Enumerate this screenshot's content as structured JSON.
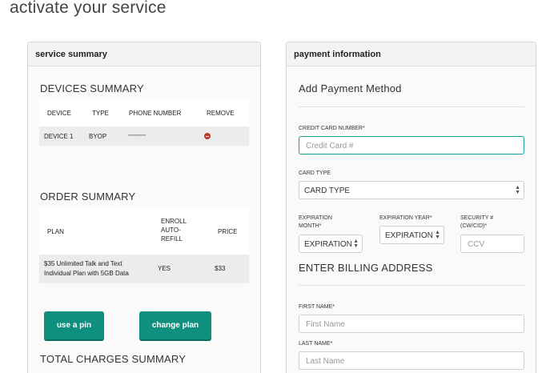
{
  "page": {
    "title": "activate your service"
  },
  "service_summary": {
    "header": "service summary",
    "devices": {
      "title": "DEVICES SUMMARY",
      "columns": [
        "DEVICE",
        "TYPE",
        "PHONE NUMBER",
        "REMOVE"
      ],
      "rows": [
        {
          "device": "DEVICE 1",
          "type": "BYOP",
          "phone_number": "▪▪▪▪▪▪▪▪▪▪▪",
          "remove_icon": "remove-circle-icon"
        }
      ]
    },
    "order": {
      "title": "ORDER SUMMARY",
      "columns": {
        "plan": "PLAN",
        "enroll": "ENROLL AUTO-REFILL",
        "price": "PRICE"
      },
      "rows": [
        {
          "plan_line1": "$35 Unlimited Talk and Text",
          "plan_line2": "Individual Plan with 5GB Data",
          "enroll": "YES",
          "price": "$33"
        }
      ]
    },
    "buttons": {
      "use_pin": "use a pin",
      "change_plan": "change plan"
    },
    "total_title": "TOTAL CHARGES SUMMARY"
  },
  "payment": {
    "header": "payment information",
    "title": "Add Payment Method",
    "credit_card": {
      "label": "CREDIT CARD NUMBER*",
      "placeholder": "Credit Card #"
    },
    "card_type": {
      "label": "CARD TYPE",
      "value": "CARD TYPE"
    },
    "exp_month": {
      "label": "EXPIRATION MONTH*",
      "value": "EXPIRATION"
    },
    "exp_year": {
      "label": "EXPIRATION YEAR*",
      "value": "EXPIRATION"
    },
    "security": {
      "label": "SECURITY # (CW/CID)*",
      "placeholder": "CCV"
    },
    "billing_title": "ENTER BILLING ADDRESS",
    "first_name": {
      "label": "FIRST NAME*",
      "placeholder": "First Name"
    },
    "last_name": {
      "label": "LAST NAME*",
      "placeholder": "Last Name"
    }
  },
  "colors": {
    "accent": "#0f8f7e",
    "remove": "#c0392b",
    "focus": "#18a28f"
  }
}
